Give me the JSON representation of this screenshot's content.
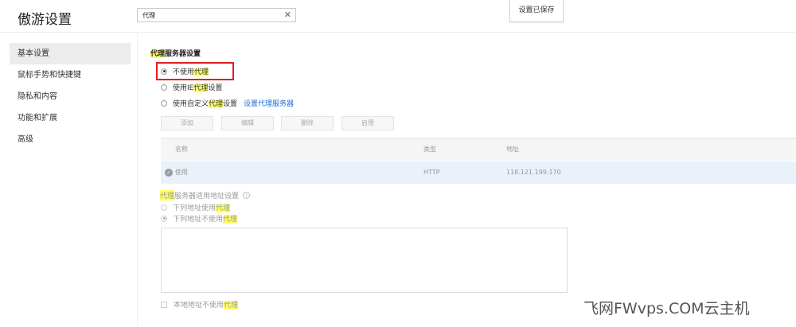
{
  "app": {
    "title": "傲游设置"
  },
  "search": {
    "value": "代理"
  },
  "header": {
    "saved_label": "设置已保存"
  },
  "sidebar": {
    "items": [
      {
        "label": "基本设置",
        "active": true
      },
      {
        "label": "鼠标手势和快捷键"
      },
      {
        "label": "隐私和内容"
      },
      {
        "label": "功能和扩展"
      },
      {
        "label": "高级"
      }
    ]
  },
  "proxy": {
    "section_title_hl": "代理",
    "section_title_rest": "服务器设置",
    "options": [
      {
        "pre": "不使用",
        "hl": "代理",
        "post": "",
        "checked": true
      },
      {
        "pre": "使用IE",
        "hl": "代理",
        "post": "设置",
        "checked": false
      },
      {
        "pre": "使用自定义",
        "hl": "代理",
        "post": "设置",
        "checked": false
      }
    ],
    "configure_link": "设置代理服务器",
    "buttons": {
      "add": "添加",
      "edit": "编辑",
      "delete": "删除",
      "enable": "启用"
    },
    "table": {
      "headers": [
        "名称",
        "类型",
        "地址"
      ],
      "rows": [
        {
          "name": "使用",
          "type": "HTTP",
          "address": "118.121.199.170"
        }
      ]
    },
    "scope": {
      "title_hl": "代理",
      "title_rest": "服务器适用地址设置",
      "options": [
        {
          "pre": "下列地址使用",
          "hl": "代理",
          "checked": false
        },
        {
          "pre": "下列地址不使用",
          "hl": "代理",
          "checked": true
        }
      ],
      "local_pre": "本地地址不使用",
      "local_hl": "代理"
    }
  },
  "watermark": "飞网FWvps.COM云主机",
  "colors": {
    "highlight": "#ffff66",
    "red_box": "#e02020",
    "link": "#1a6fd1",
    "selected_row": "#e9f1fb"
  }
}
